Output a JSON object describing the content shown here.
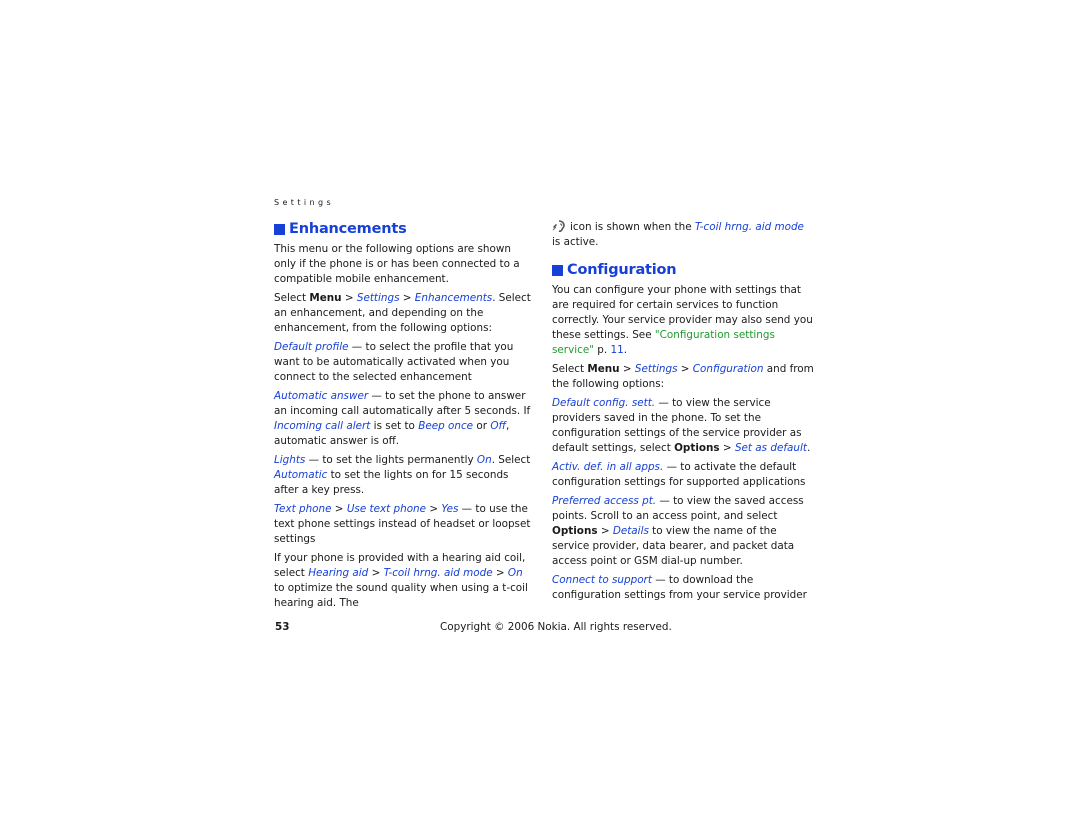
{
  "running_head": "Settings",
  "left_column": {
    "heading": "Enhancements",
    "intro": "This menu or the following options are shown only if the phone is or has been connected to a compatible mobile enhancement.",
    "select_path": {
      "prefix": "Select ",
      "menu": "Menu",
      "sep": " > ",
      "item1": "Settings",
      "item2": "Enhancements",
      "suffix": ". Select an enhancement, and depending on the enhancement, from the following options:"
    },
    "default_profile": {
      "term": "Default profile",
      "text": " — to select the profile that you want to be automatically activated when you connect to the selected enhancement"
    },
    "automatic_answer": {
      "term": "Automatic answer",
      "text1": " — to set the phone to answer an incoming call automatically after 5 seconds. If ",
      "ref1": "Incoming call alert",
      "text2": " is set to ",
      "ref2": "Beep once",
      "text3": " or ",
      "ref3": "Off",
      "text4": ", automatic answer is off."
    },
    "lights": {
      "term": "Lights",
      "text1": " — to set the lights permanently ",
      "ref1": "On",
      "text2": ". Select ",
      "ref2": "Automatic",
      "text3": " to set the lights on for 15 seconds after a key press."
    },
    "text_phone": {
      "term1": "Text phone",
      "sep": " > ",
      "term2": "Use text phone",
      "term3": "Yes",
      "text": " — to use the text phone settings instead of headset or loopset settings"
    },
    "hearing_aid": {
      "text1": "If your phone is provided with a hearing aid coil, select ",
      "ref1": "Hearing aid",
      "sep": " > ",
      "ref2": "T-coil hrng. aid mode",
      "ref3": "On",
      "text2": " to optimize the sound quality when using a t-coil hearing aid. The"
    }
  },
  "right_column": {
    "icon_note": {
      "icon": "hearing-aid-icon",
      "text1": "icon is shown when the ",
      "ref": "T-coil hrng. aid mode",
      "text2": " is active."
    },
    "heading": "Configuration",
    "intro": {
      "text": "You can configure your phone with settings that are required for certain services to function correctly. Your service provider may also send you these settings. See ",
      "xref": "\"Configuration settings service\"",
      "page_prefix": " p. ",
      "page": "11",
      "end": "."
    },
    "select_path": {
      "prefix": "Select ",
      "menu": "Menu",
      "sep": " > ",
      "item1": "Settings",
      "item2": "Configuration",
      "suffix": " and from the following options:"
    },
    "default_config": {
      "term": "Default config. sett.",
      "text1": " — to view the service providers saved in the phone. To set the configuration settings of the service provider as default settings, select ",
      "options": "Options",
      "sep": " > ",
      "ref": "Set as default",
      "end": "."
    },
    "activ_def": {
      "term": "Activ. def. in all apps.",
      "text": " — to activate the default configuration settings for supported applications"
    },
    "preferred_access": {
      "term": "Preferred access pt.",
      "text1": " — to view the saved access points. Scroll to an access point, and select ",
      "options": "Options",
      "sep": " > ",
      "ref": "Details",
      "text2": " to view the name of the service provider, data bearer, and packet data access point or GSM dial-up number."
    },
    "connect_support": {
      "term": "Connect to support",
      "text": " — to download the configuration settings from your service provider"
    }
  },
  "footer": {
    "page_number": "53",
    "copyright": "Copyright © 2006 Nokia. All rights reserved."
  },
  "colors": {
    "heading_blue": "#1640d6",
    "xref_green": "#1e9b2e"
  }
}
